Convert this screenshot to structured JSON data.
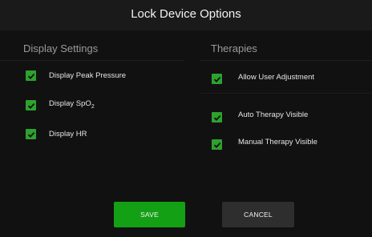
{
  "window": {
    "title": "Lock Device Options"
  },
  "display_settings": {
    "header": "Display Settings",
    "options": [
      {
        "label": "Display Peak Pressure",
        "checked": true
      },
      {
        "label_main": "Display SpO",
        "label_sub": "2",
        "checked": true
      },
      {
        "label": "Display HR",
        "checked": true
      }
    ]
  },
  "therapies": {
    "header": "Therapies",
    "options": [
      {
        "label": "Allow User Adjustment",
        "checked": true
      },
      {
        "label": "Auto Therapy Visible",
        "checked": true
      },
      {
        "label": "Manual Therapy Visible",
        "checked": true
      }
    ]
  },
  "buttons": {
    "save_label": "SAVE",
    "cancel_label": "CANCEL"
  },
  "colors": {
    "checkbox": "#2ea12e",
    "save_button": "#14a014",
    "cancel_button": "#2e2e2e",
    "background": "#111111",
    "title_bar": "#1a1a1a"
  }
}
